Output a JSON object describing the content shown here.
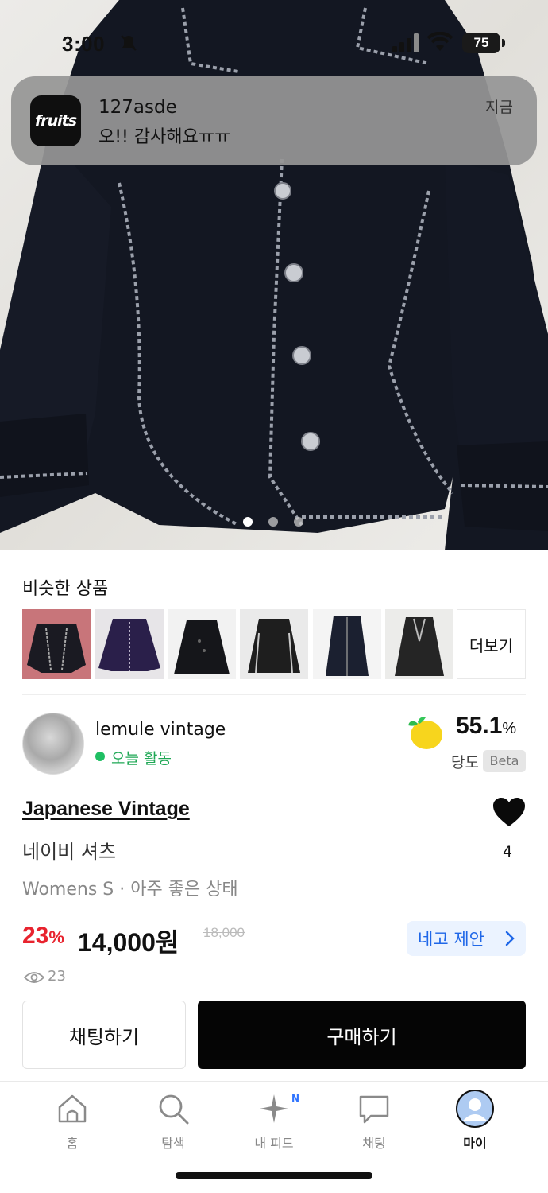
{
  "status_bar": {
    "time": "3:00",
    "battery": "75"
  },
  "notification": {
    "app_icon_text": "fruits",
    "sender": "127asde",
    "message": "오!! 감사해요ㅠㅠ",
    "time": "지금"
  },
  "carousel": {
    "total_images": 3,
    "current_index": 0
  },
  "similar": {
    "title": "비슷한 상품",
    "more_label": "더보기"
  },
  "seller": {
    "name": "lemule vintage",
    "activity": "오늘 활동",
    "score_value": "55.1",
    "score_unit": "%",
    "score_label": "당도",
    "beta_label": "Beta"
  },
  "product": {
    "brand": "Japanese Vintage",
    "name": "네이비 셔츠",
    "meta": "Womens S · 아주 좋은 상태",
    "likes": "4",
    "discount_value": "23",
    "discount_unit": "%",
    "price": "14,000원",
    "original_price": "18,000",
    "offer_label": "네고 제안",
    "views": "23"
  },
  "actions": {
    "chat_label": "채팅하기",
    "buy_label": "구매하기"
  },
  "tabbar": {
    "items": [
      {
        "label": "홈",
        "icon": "home-icon"
      },
      {
        "label": "탐색",
        "icon": "search-icon"
      },
      {
        "label": "내 피드",
        "icon": "sparkle-icon",
        "badge": "N"
      },
      {
        "label": "채팅",
        "icon": "chat-icon"
      },
      {
        "label": "마이",
        "icon": "profile-icon",
        "active": true
      }
    ]
  },
  "colors": {
    "discount": "#e8232e",
    "offer_text": "#1f67e8",
    "active_green": "#1fbf63",
    "badge_blue": "#2f74ff"
  }
}
